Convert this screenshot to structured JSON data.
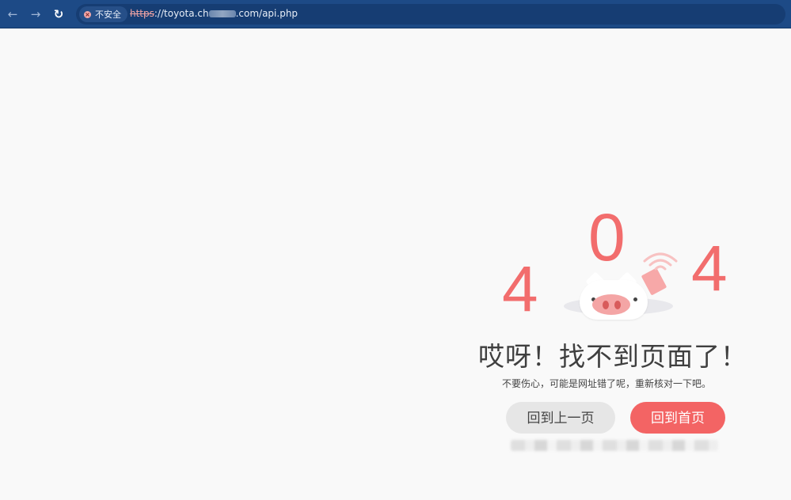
{
  "browser": {
    "security_label": "不安全",
    "url_scheme": "https",
    "url_host_prefix": "://toyota.ch",
    "url_rest": ".com/api.php",
    "nav": {
      "back": "←",
      "forward": "→",
      "reload": "↻"
    }
  },
  "error_page": {
    "digits": [
      "4",
      "0",
      "4"
    ],
    "headline": "哎呀！找不到页面了！",
    "subline": "不要伤心，可能是网址错了呢，重新核对一下吧。",
    "buttons": {
      "back_label": "回到上一页",
      "home_label": "回到首页"
    }
  },
  "colors": {
    "accent": "#f26d6d",
    "toolbar": "#1d4a86",
    "home_button": "#f36464",
    "back_button": "#e6e6e6"
  }
}
